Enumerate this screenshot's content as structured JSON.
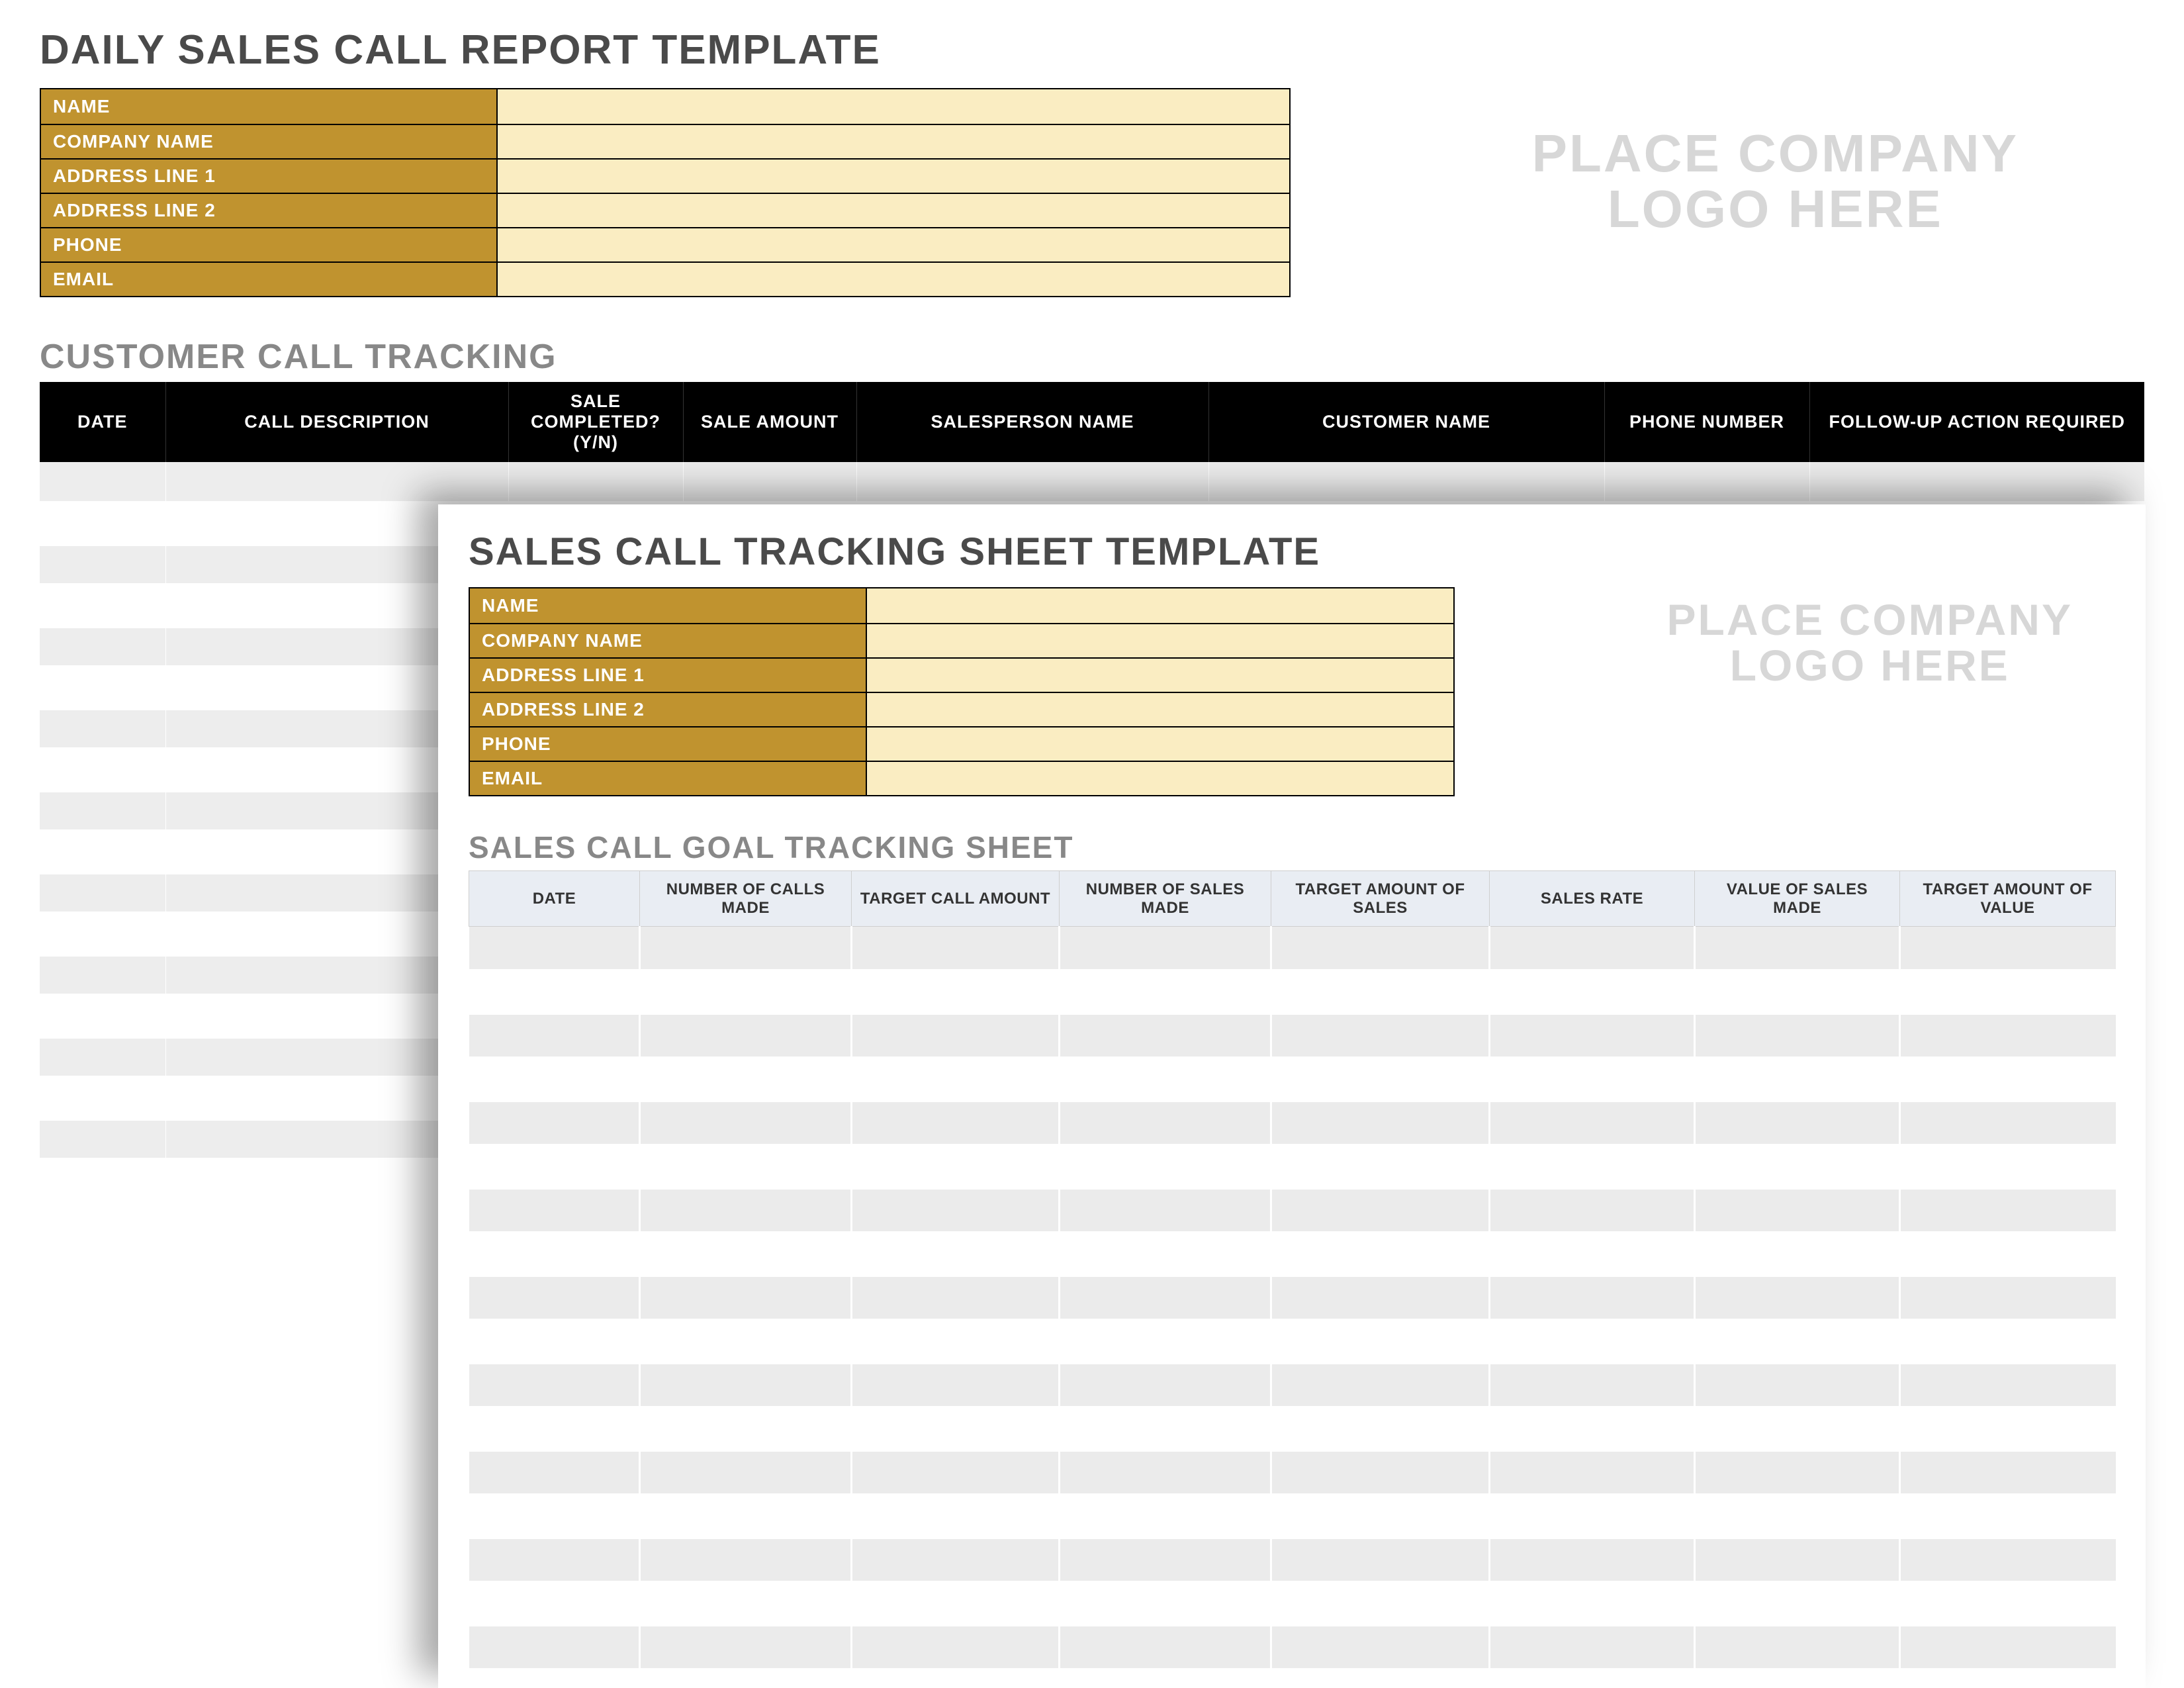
{
  "back": {
    "title": "DAILY SALES CALL REPORT TEMPLATE",
    "logo_line1": "PLACE COMPANY",
    "logo_line2": "LOGO HERE",
    "info_labels": [
      "NAME",
      "COMPANY NAME",
      "ADDRESS LINE 1",
      "ADDRESS LINE 2",
      "PHONE",
      "EMAIL"
    ],
    "info_values": [
      "",
      "",
      "",
      "",
      "",
      ""
    ],
    "section_title": "CUSTOMER CALL TRACKING",
    "columns": [
      "DATE",
      "CALL DESCRIPTION",
      "SALE COMPLETED? (Y/N)",
      "SALE AMOUNT",
      "SALESPERSON NAME",
      "CUSTOMER NAME",
      "PHONE NUMBER",
      "FOLLOW-UP ACTION REQUIRED"
    ],
    "row_count": 17
  },
  "front": {
    "title": "SALES CALL TRACKING SHEET TEMPLATE",
    "logo_line1": "PLACE COMPANY",
    "logo_line2": "LOGO HERE",
    "info_labels": [
      "NAME",
      "COMPANY NAME",
      "ADDRESS LINE 1",
      "ADDRESS LINE 2",
      "PHONE",
      "EMAIL"
    ],
    "info_values": [
      "",
      "",
      "",
      "",
      "",
      ""
    ],
    "section_title": "SALES CALL GOAL TRACKING SHEET",
    "columns": [
      "DATE",
      "NUMBER OF CALLS MADE",
      "TARGET CALL AMOUNT",
      "NUMBER OF SALES MADE",
      "TARGET AMOUNT OF SALES",
      "SALES RATE",
      "VALUE OF SALES MADE",
      "TARGET AMOUNT OF VALUE"
    ],
    "row_count": 17
  }
}
